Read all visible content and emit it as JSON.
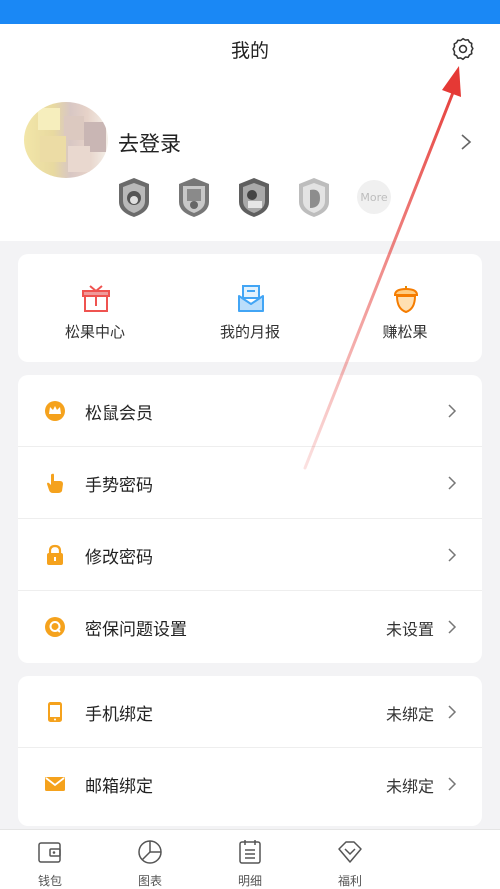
{
  "header": {
    "title": "我的"
  },
  "profile": {
    "login_text": "去登录",
    "more_label": "More"
  },
  "quick_actions": [
    {
      "label": "松果中心",
      "icon": "gift-icon"
    },
    {
      "label": "我的月报",
      "icon": "mail-report-icon"
    },
    {
      "label": "赚松果",
      "icon": "acorn-icon"
    }
  ],
  "menu_security": [
    {
      "label": "松鼠会员",
      "value": "",
      "icon": "crown-icon"
    },
    {
      "label": "手势密码",
      "value": "",
      "icon": "hand-pointer-icon"
    },
    {
      "label": "修改密码",
      "value": "",
      "icon": "lock-icon"
    },
    {
      "label": "密保问题设置",
      "value": "未设置",
      "icon": "question-q-icon"
    }
  ],
  "menu_binding": [
    {
      "label": "手机绑定",
      "value": "未绑定",
      "icon": "phone-icon"
    },
    {
      "label": "邮箱绑定",
      "value": "未绑定",
      "icon": "envelope-icon"
    }
  ],
  "tabbar": [
    {
      "label": "钱包",
      "icon": "wallet-icon"
    },
    {
      "label": "图表",
      "icon": "pie-chart-icon"
    },
    {
      "label": "明细",
      "icon": "calendar-list-icon"
    },
    {
      "label": "福利",
      "icon": "diamond-icon"
    }
  ],
  "colors": {
    "status_bar": "#1a88f5",
    "accent_orange": "#f5a21d",
    "annotation_red": "#e53935"
  }
}
